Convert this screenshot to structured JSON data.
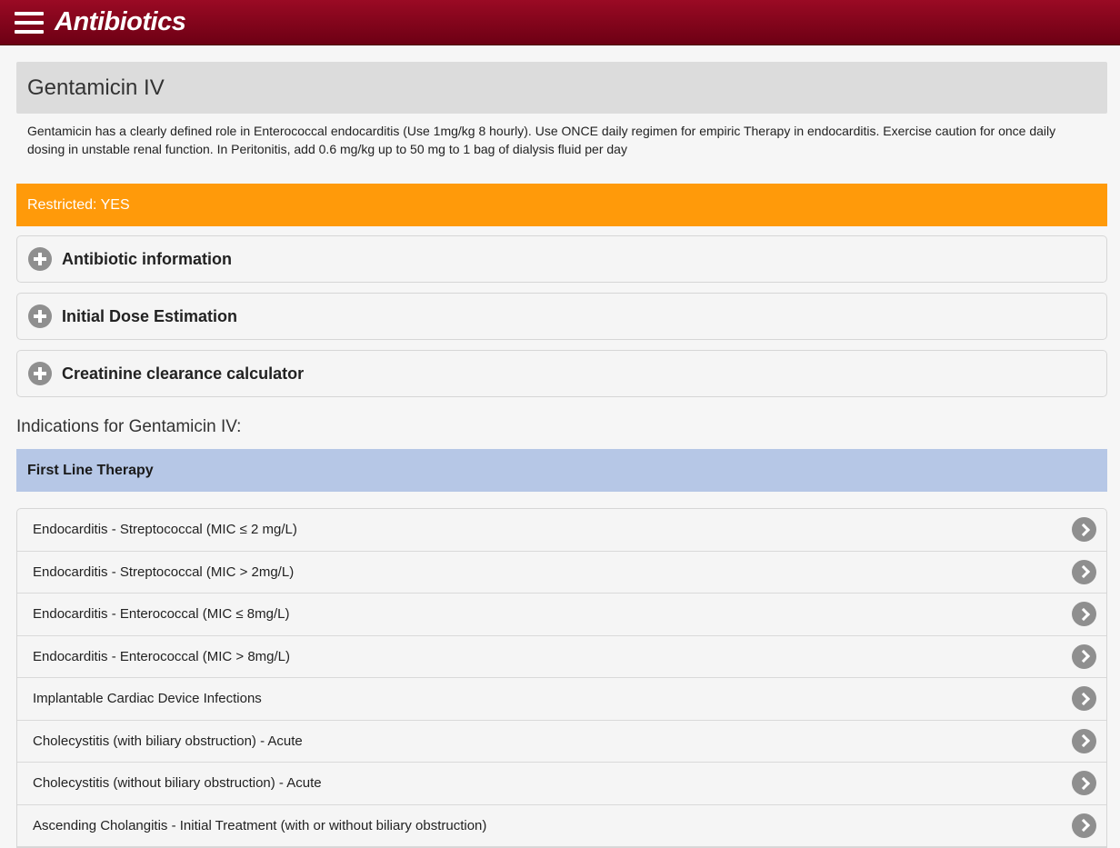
{
  "header": {
    "title": "Antibiotics",
    "menu_icon": "hamburger-menu-icon",
    "bar_color": "#800018"
  },
  "drug": {
    "name": "Gentamicin IV",
    "description": "Gentamicin has a clearly defined role in Enterococcal endocarditis (Use 1mg/kg 8 hourly). Use ONCE daily regimen for empiric Therapy in endocarditis. Exercise caution for once daily dosing in unstable renal function. In Peritonitis, add 0.6 mg/kg up to 50 mg to 1 bag of dialysis fluid per day",
    "restricted": "Restricted: YES",
    "restricted_color": "#ff9a0a"
  },
  "sections": [
    {
      "label": "Antibiotic information",
      "icon": "plus-circle-icon"
    },
    {
      "label": "Initial Dose Estimation",
      "icon": "plus-circle-icon"
    },
    {
      "label": "Creatinine clearance calculator",
      "icon": "plus-circle-icon"
    }
  ],
  "indications": {
    "heading": "Indications for Gentamicin IV:",
    "group_label": "First Line Therapy",
    "group_color": "#b6c7e6",
    "items": [
      "Endocarditis - Streptococcal (MIC ≤ 2 mg/L)",
      "Endocarditis - Streptococcal (MIC > 2mg/L)",
      "Endocarditis - Enterococcal (MIC ≤ 8mg/L)",
      "Endocarditis - Enterococcal (MIC > 8mg/L)",
      "Implantable Cardiac Device Infections",
      "Cholecystitis (with biliary obstruction) - Acute",
      "Cholecystitis (without biliary obstruction) - Acute",
      "Ascending Cholangitis - Initial Treatment (with or without biliary obstruction)"
    ]
  }
}
